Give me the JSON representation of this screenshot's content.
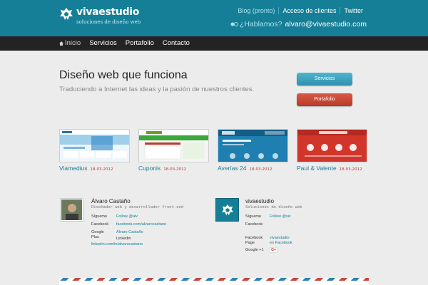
{
  "brand": {
    "name": "vivaestudio",
    "tagline": "soluciones de diseño web"
  },
  "toplinks": {
    "blog": "Blog (pronto)",
    "access": "Acceso de clientes",
    "twitter": "Twitter"
  },
  "contact": {
    "talk": "¿Hablamos?",
    "email": "alvaro@vivaestudio.com"
  },
  "nav": {
    "items": [
      "Inicio",
      "Servicios",
      "Portafolio",
      "Contacto"
    ]
  },
  "hero": {
    "title": "Diseño web que funciona",
    "subtitle": "Traduciendo a Internet las ideas y la pasión de nuestros clientes.",
    "btn_services": "Servicios",
    "btn_portfolio": "Portafolio"
  },
  "portfolio": [
    {
      "name": "Viamedius",
      "date": "18-03-2012"
    },
    {
      "name": "Cuponis",
      "date": "18-03-2012"
    },
    {
      "name": "Averías 24",
      "date": "18-03-2012"
    },
    {
      "name": "Paul & Valente",
      "date": "18-03-2012"
    }
  ],
  "person": {
    "name": "Álvaro Castaño",
    "role": "Diseñador web y desarrollador front-end",
    "follow_label": "Sígueme",
    "follow_value": "Follow @alv",
    "facebook_label": "Facebook",
    "facebook_value": "facebook.com/alvarocastano",
    "gplus_label_1": "Google",
    "gplus_label_2": "Plus",
    "gplus_value": "Álvaro Castaño",
    "linkedin_label": "Linkedin",
    "linkedin_value": "linkedin.com/in/alvarocastano"
  },
  "company": {
    "name": "vivaestudio",
    "role": "Soluciones de diseño web",
    "follow_label": "Sígueme",
    "follow_value": "Follow @viv",
    "facebook_label": "Facebook",
    "fbpage_label_1": "Facebook",
    "fbpage_label_2": "Page",
    "fbpage_value_1": "vivaestudio",
    "fbpage_value_2": "en Facebook",
    "gplus_label": "Google +1",
    "gplus_badge": "G+"
  },
  "colors": {
    "brand_teal": "#157f97",
    "nav_dark": "#232323",
    "accent_red": "#c0392b",
    "button_blue": "#2f90ad"
  }
}
